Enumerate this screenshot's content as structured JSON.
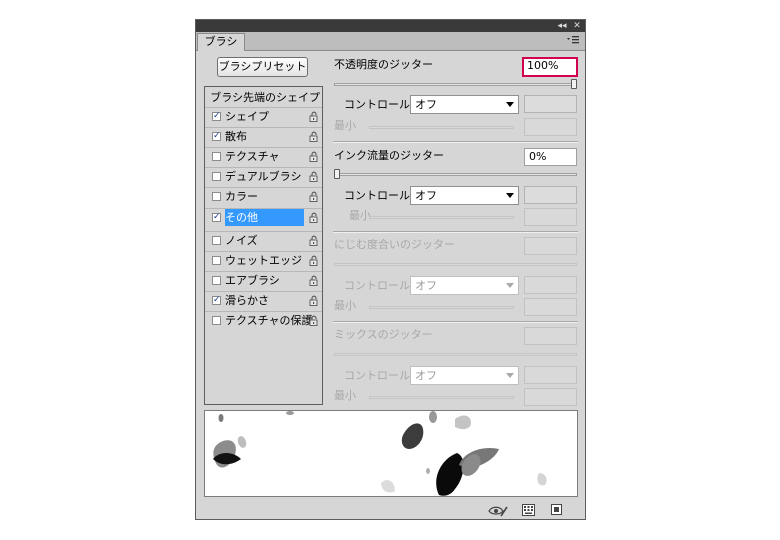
{
  "panel": {
    "tab_label": "ブラシ",
    "preset_button": "ブラシプリセット",
    "list_header": "ブラシ先端のシェイプ",
    "items": [
      {
        "label": "シェイプ",
        "checked": true,
        "selected": false
      },
      {
        "label": "散布",
        "checked": true,
        "selected": false
      },
      {
        "label": "テクスチャ",
        "checked": false,
        "selected": false
      },
      {
        "label": "デュアルブラシ",
        "checked": false,
        "selected": false
      },
      {
        "label": "カラー",
        "checked": false,
        "selected": false
      },
      {
        "label": "その他",
        "checked": true,
        "selected": true
      },
      {
        "label": "ノイズ",
        "checked": false,
        "selected": false
      },
      {
        "label": "ウェットエッジ",
        "checked": false,
        "selected": false
      },
      {
        "label": "エアブラシ",
        "checked": false,
        "selected": false
      },
      {
        "label": "滑らかさ",
        "checked": true,
        "selected": false
      },
      {
        "label": "テクスチャの保護",
        "checked": false,
        "selected": false
      }
    ],
    "check_mark": "✓"
  },
  "settings": {
    "opacity_jitter": {
      "label": "不透明度のジッター",
      "value": "100%",
      "level": 1.0
    },
    "opacity_control": {
      "label": "コントロール：",
      "value": "オフ"
    },
    "opacity_min": {
      "label": "最小"
    },
    "flow_jitter": {
      "label": "インク流量のジッター",
      "value": "0%",
      "level": 0.0
    },
    "flow_control": {
      "label": "コントロール：",
      "value": "オフ"
    },
    "flow_min": {
      "label": "最小"
    },
    "wetness_jitter": {
      "label": "にじむ度合いのジッター"
    },
    "wetness_control": {
      "label": "コントロール：",
      "value": "オフ"
    },
    "wetness_min": {
      "label": "最小"
    },
    "mix_jitter": {
      "label": "ミックスのジッター"
    },
    "mix_control": {
      "label": "コントロール：",
      "value": "オフ"
    },
    "mix_min": {
      "label": "最小"
    }
  },
  "icons": {
    "collapse": "◂◂",
    "close": "✕",
    "lock": "lock-icon",
    "eye": "eye-brush-icon",
    "grid": "grid-icon",
    "new": "new-preset-icon"
  },
  "colors": {
    "highlight_border": "#d3004f",
    "selection": "#3399ff"
  }
}
